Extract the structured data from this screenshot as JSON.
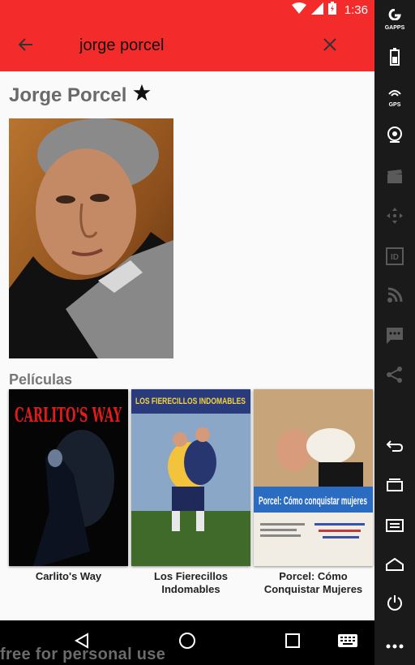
{
  "status_bar": {
    "time": "1:36",
    "icons": [
      "wifi-icon",
      "signal-icon",
      "battery-charging-icon"
    ]
  },
  "app_bar": {
    "back_icon": "arrow-back-icon",
    "search_value": "jorge porcel",
    "clear_icon": "close-icon",
    "color": "#f42b2b"
  },
  "person": {
    "name": "Jorge Porcel",
    "favorite_icon": "star-icon"
  },
  "movies_section": {
    "title": "Películas",
    "movies": [
      {
        "title": "Carlito's Way",
        "poster_text": "CARLITO'S WAY"
      },
      {
        "title": "Los Fierecillos Indomables",
        "poster_text": "LOS FIERECILLOS INDOMABLES"
      },
      {
        "title": "Porcel: Cómo Conquistar Mujeres",
        "poster_text": "Porcel: Cómo conquistar mujeres"
      }
    ]
  },
  "nav_bar": {
    "buttons": [
      "back-triangle-icon",
      "home-circle-icon",
      "recents-square-icon",
      "keyboard-icon"
    ]
  },
  "watermark": "free for personal use",
  "side_toolbar": {
    "items": [
      {
        "icon": "gapps-icon",
        "label": "GAPPS"
      },
      {
        "icon": "battery-icon",
        "label": ""
      },
      {
        "icon": "gps-icon",
        "label": "GPS"
      },
      {
        "icon": "camera-icon",
        "label": ""
      },
      {
        "icon": "clapperboard-icon",
        "label": ""
      },
      {
        "icon": "dpad-icon",
        "label": ""
      },
      {
        "icon": "id-icon",
        "label": "ID"
      },
      {
        "icon": "rss-icon",
        "label": ""
      },
      {
        "icon": "sms-icon",
        "label": ""
      },
      {
        "icon": "share-icon",
        "label": ""
      },
      {
        "icon": "back-icon",
        "label": ""
      },
      {
        "icon": "recent-apps-icon",
        "label": ""
      },
      {
        "icon": "menu-icon",
        "label": ""
      },
      {
        "icon": "home-icon",
        "label": ""
      },
      {
        "icon": "power-icon",
        "label": ""
      },
      {
        "icon": "more-icon",
        "label": ""
      }
    ]
  }
}
